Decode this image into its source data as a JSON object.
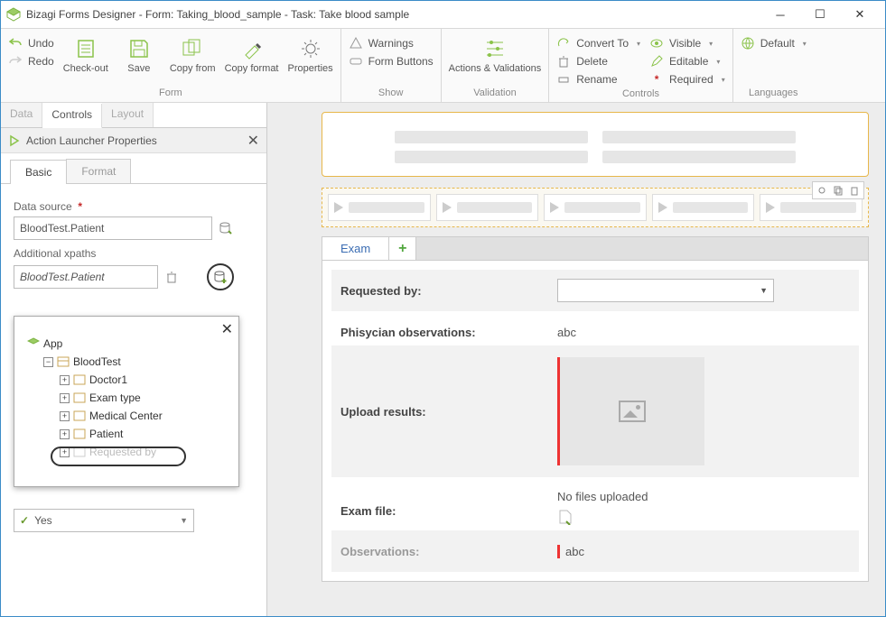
{
  "window": {
    "title": "Bizagi Forms Designer  - Form: Taking_blood_sample - Task:  Take blood sample"
  },
  "ribbon": {
    "undo": "Undo",
    "redo": "Redo",
    "form": {
      "checkout": "Check-out",
      "save": "Save",
      "copyfrom": "Copy from",
      "copyformat": "Copy format",
      "properties": "Properties",
      "group": "Form"
    },
    "show": {
      "warnings": "Warnings",
      "formbuttons": "Form Buttons",
      "group": "Show"
    },
    "validation": {
      "actions": "Actions & Validations",
      "group": "Validation"
    },
    "controls": {
      "convert": "Convert To",
      "delete": "Delete",
      "rename": "Rename",
      "visible": "Visible",
      "editable": "Editable",
      "required": "Required",
      "group": "Controls"
    },
    "languages": {
      "default": "Default",
      "group": "Languages"
    }
  },
  "leftTabs": {
    "data": "Data",
    "controls": "Controls",
    "layout": "Layout"
  },
  "panel": {
    "title": "Action Launcher Properties",
    "subtabs": {
      "basic": "Basic",
      "format": "Format"
    },
    "datasource_label": "Data source",
    "datasource_value": "BloodTest.Patient",
    "xpaths_label": "Additional xpaths",
    "xpaths_value": "BloodTest.Patient",
    "yes": "Yes"
  },
  "tree": {
    "root": "App",
    "n1": "BloodTest",
    "n2": "Doctor1",
    "n3": "Exam type",
    "n4": "Medical Center",
    "n5": "Patient",
    "n6": "Requested by"
  },
  "form": {
    "tab": "Exam",
    "requested_by": "Requested by:",
    "phys_obs_label": "Phisycian observations:",
    "phys_obs_val": "abc",
    "upload_label": "Upload results:",
    "examfile_label": "Exam file:",
    "examfile_val": "No files uploaded",
    "observations_label": "Observations:",
    "observations_val": "abc"
  }
}
